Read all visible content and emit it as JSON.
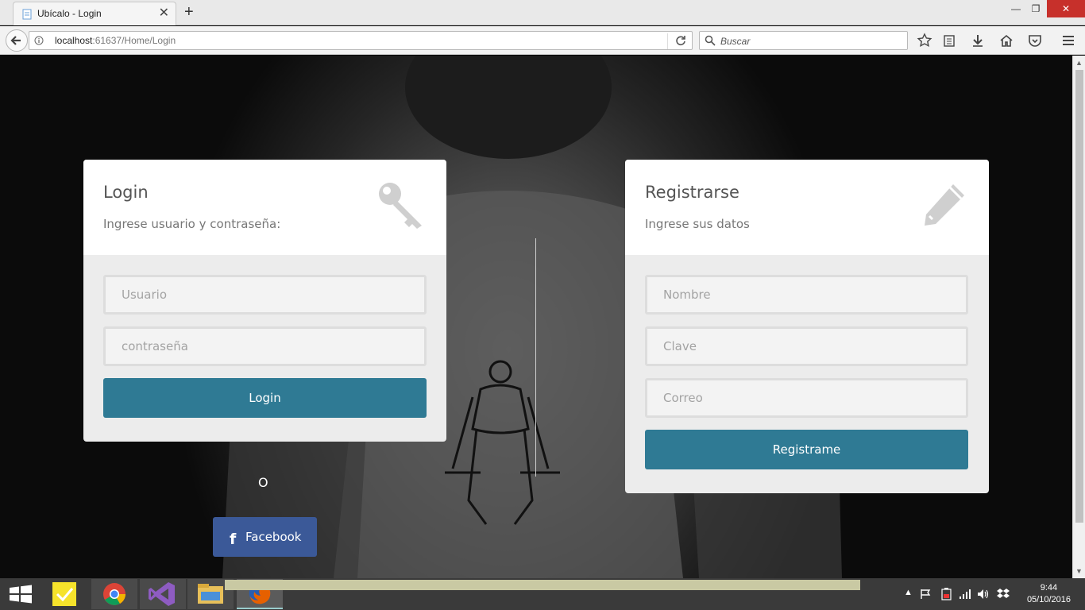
{
  "browser": {
    "tab_title": "Ubícalo - Login",
    "tab_close": "✕",
    "new_tab": "+",
    "url_host": "localhost",
    "url_rest": ":61637/Home/Login",
    "search_placeholder": "Buscar",
    "window_controls": {
      "minimize": "—",
      "maximize": "❐",
      "close": "✕"
    }
  },
  "login": {
    "title": "Login",
    "subtitle": "Ingrese usuario y contraseña:",
    "user_placeholder": "Usuario",
    "password_placeholder": "contraseña",
    "submit_label": "Login"
  },
  "register": {
    "title": "Registrarse",
    "subtitle": "Ingrese sus datos",
    "name_placeholder": "Nombre",
    "password_placeholder": "Clave",
    "email_placeholder": "Correo",
    "submit_label": "Registrame"
  },
  "social": {
    "or_text": "O",
    "facebook_icon_glyph": "f",
    "facebook_label": "Facebook"
  },
  "taskbar": {
    "apps": [
      "windows-start",
      "sticky-notes",
      "chrome",
      "visual-studio",
      "file-explorer",
      "firefox"
    ],
    "clock_time": "9:44",
    "clock_date": "05/10/2016"
  },
  "colors": {
    "button_primary": "#2f7a94",
    "facebook": "#3b5998",
    "windows_close": "#c7302b"
  }
}
